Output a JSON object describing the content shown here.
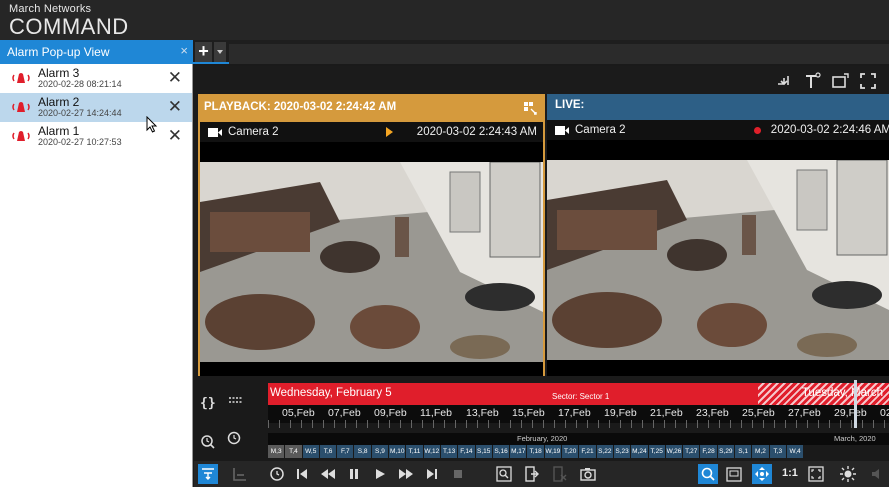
{
  "app": {
    "brand_top": "March Networks",
    "brand_main": "COMMAND"
  },
  "tabs": {
    "active_label": "Alarm Pop-up View",
    "close_glyph": "×",
    "add_glyph": "+"
  },
  "alarms": [
    {
      "title": "Alarm 3",
      "timestamp": "2020-02-28 08:21:14",
      "close": "✕",
      "selected": false
    },
    {
      "title": "Alarm 2",
      "timestamp": "2020-02-27 14:24:44",
      "close": "✕",
      "selected": true
    },
    {
      "title": "Alarm 1",
      "timestamp": "2020-02-27 10:27:53",
      "close": "✕",
      "selected": false
    }
  ],
  "playback": {
    "header": "PLAYBACK: 2020-03-02 2:24:42 AM",
    "camera": "Camera 2",
    "time": "2020-03-02 2:24:43 AM"
  },
  "live": {
    "header": "LIVE:",
    "camera": "Camera 2",
    "time": "2020-03-02 2:24:46 AM"
  },
  "timeline": {
    "date_left": "Wednesday, February 5",
    "sector": "Sector: Sector 1",
    "date_right": "Tuesday, March",
    "days": [
      "05,Feb",
      "07,Feb",
      "09,Feb",
      "11,Feb",
      "13,Feb",
      "15,Feb",
      "17,Feb",
      "19,Feb",
      "21,Feb",
      "23,Feb",
      "25,Feb",
      "27,Feb",
      "29,Feb",
      "02"
    ],
    "month_feb": "February, 2020",
    "month_mar": "March, 2020",
    "cells": [
      "M,3",
      "T,4",
      "W,5",
      "T,6",
      "F,7",
      "S,8",
      "S,9",
      "M,10",
      "T,11",
      "W,12",
      "T,13",
      "F,14",
      "S,15",
      "S,16",
      "M,17",
      "T,18",
      "W,19",
      "T,20",
      "F,21",
      "S,22",
      "S,23",
      "M,24",
      "T,25",
      "W,26",
      "T,27",
      "F,28",
      "S,29",
      "S,1",
      "M,2",
      "T,3",
      "W,4"
    ],
    "gray_cells": [
      0,
      1
    ]
  },
  "toolbar": {
    "ratio": "1:1"
  },
  "colors": {
    "accent": "#1f87d6",
    "playback": "#d59a3d",
    "live": "#2d5f86",
    "alarm_red": "#e01e2b"
  },
  "icons": [
    "bell-icon",
    "close-icon",
    "grid-icon",
    "camera-icon",
    "play-icon",
    "record-icon",
    "clock-icon",
    "skip-back-icon",
    "rewind-icon",
    "pause-icon",
    "play-icon",
    "fast-forward-icon",
    "skip-forward-icon",
    "stop-icon",
    "search-icon",
    "export-icon",
    "snapshot-icon",
    "zoom-icon",
    "fullscreen-icon",
    "brightness-icon"
  ]
}
